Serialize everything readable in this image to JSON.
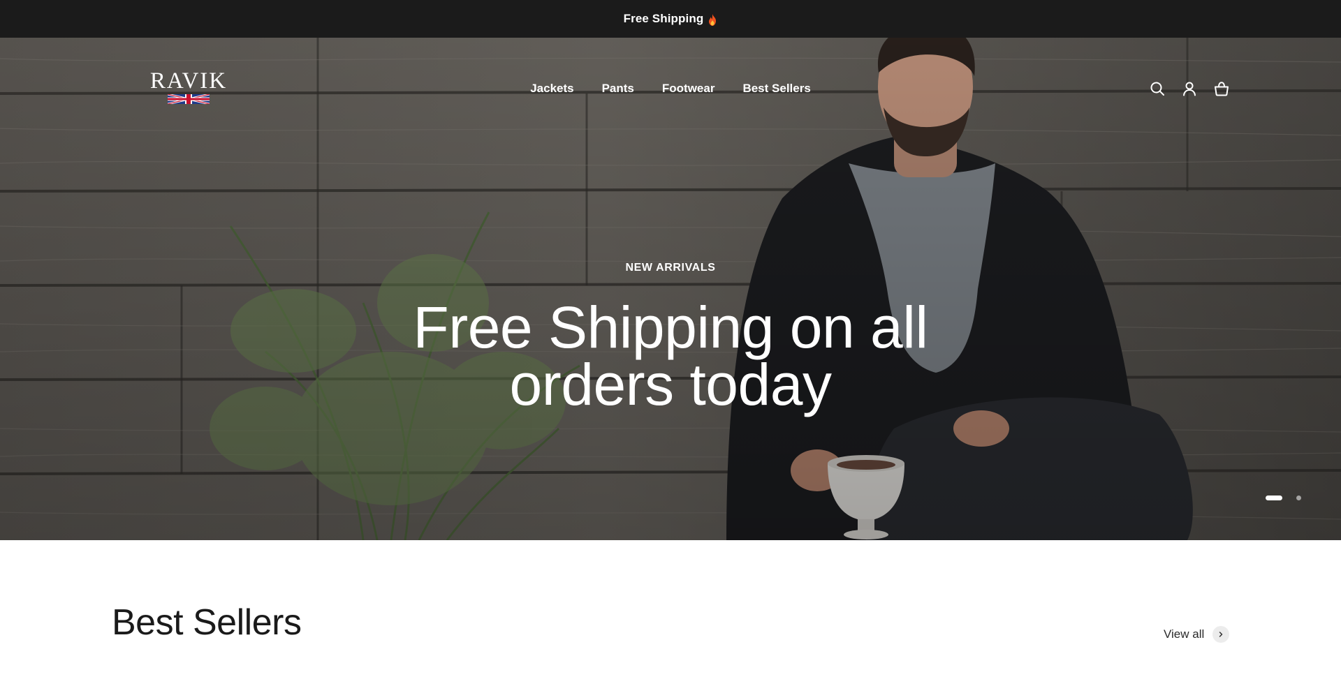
{
  "announcement": {
    "text": "Free Shipping",
    "icon": "fire-icon"
  },
  "header": {
    "logo_text": "RAVIK",
    "nav": [
      {
        "label": "Jackets"
      },
      {
        "label": "Pants"
      },
      {
        "label": "Footwear"
      },
      {
        "label": "Best Sellers"
      }
    ],
    "icons": [
      "search-icon",
      "account-icon",
      "cart-icon"
    ]
  },
  "hero": {
    "eyebrow": "NEW ARRIVALS",
    "title": "Free Shipping on all orders today",
    "slides_total": 2,
    "active_slide": 1
  },
  "best_sellers": {
    "title": "Best Sellers",
    "view_all": "View all"
  },
  "colors": {
    "announcement_bg": "#1b1b1b",
    "text_light": "#ffffff",
    "text_dark": "#1a1a1a"
  }
}
